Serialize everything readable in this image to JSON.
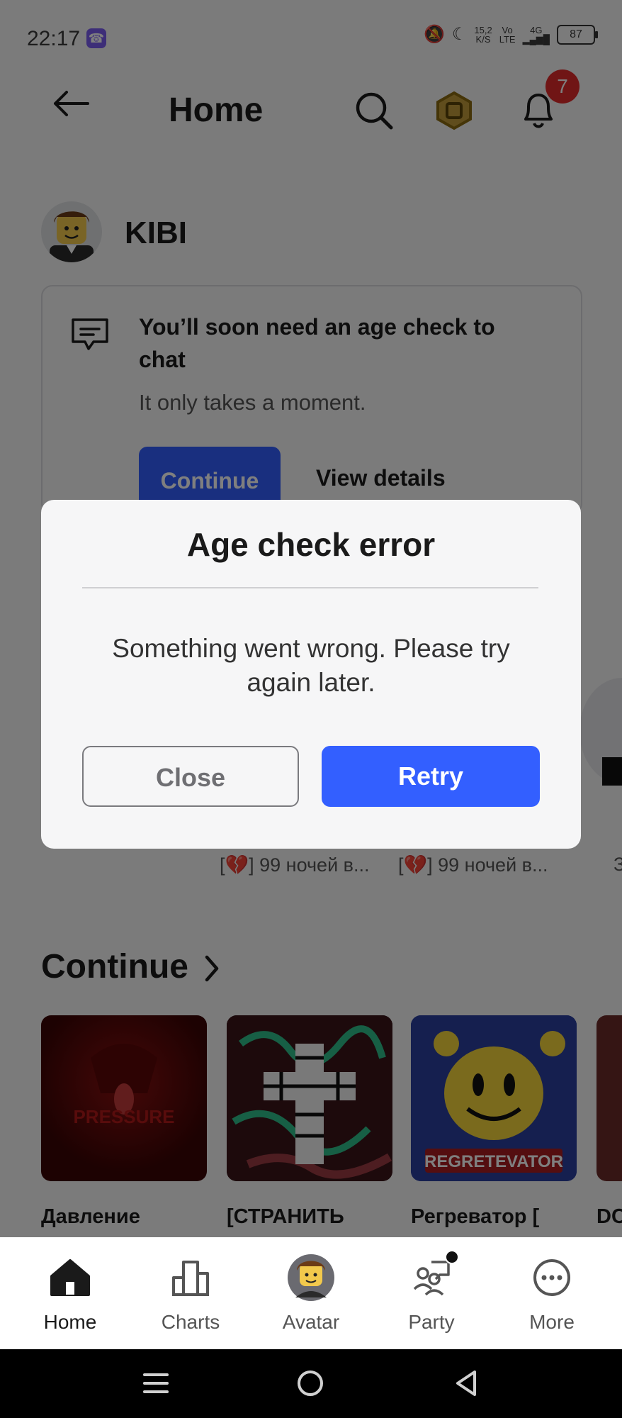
{
  "status_bar": {
    "time": "22:17",
    "net_speed_top": "15,2",
    "net_speed_bottom": "K/S",
    "volte_top": "Vo",
    "volte_bottom": "LTE",
    "network": "4G",
    "battery": "87"
  },
  "header": {
    "title": "Home",
    "notifications_count": "7"
  },
  "user": {
    "name": "KIBI"
  },
  "age_banner": {
    "title": "You’ll soon need an age check to chat",
    "subtitle": "It only takes a moment.",
    "continue_label": "Continue",
    "details_label": "View details"
  },
  "experience_labels": [
    "[💔] 99 ночей в...",
    "[💔] 99 ночей в...",
    "З"
  ],
  "continue_section": {
    "title": "Continue",
    "games": [
      {
        "title": "Давление",
        "thumb_text": "PRESSURE"
      },
      {
        "title": "[СТРАНИТЬ",
        "thumb_text": ""
      },
      {
        "title": "Регреватор [",
        "thumb_text": "REGRETEVATOR"
      },
      {
        "title": "DC",
        "thumb_text": ""
      }
    ]
  },
  "modal": {
    "title": "Age check error",
    "message": "Something went wrong. Please try again later.",
    "close_label": "Close",
    "retry_label": "Retry"
  },
  "bottom_nav": {
    "items": [
      {
        "label": "Home",
        "icon": "home-icon",
        "active": true
      },
      {
        "label": "Charts",
        "icon": "charts-icon",
        "active": false
      },
      {
        "label": "Avatar",
        "icon": "avatar-icon",
        "active": false
      },
      {
        "label": "Party",
        "icon": "party-icon",
        "active": false
      },
      {
        "label": "More",
        "icon": "more-icon",
        "active": false
      }
    ]
  },
  "colors": {
    "accent": "#335fff",
    "badge": "#e02b2b"
  }
}
